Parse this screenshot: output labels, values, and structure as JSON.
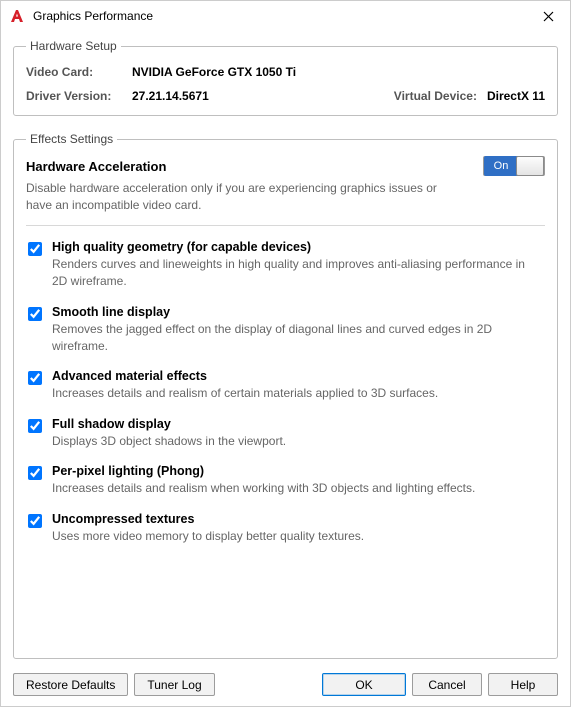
{
  "window": {
    "title": "Graphics Performance"
  },
  "hardware": {
    "legend": "Hardware Setup",
    "video_card_label": "Video Card:",
    "video_card_value": "NVIDIA GeForce GTX 1050 Ti",
    "driver_label": "Driver Version:",
    "driver_value": "27.21.14.5671",
    "virtual_device_label": "Virtual Device:",
    "virtual_device_value": "DirectX 11"
  },
  "effects": {
    "legend": "Effects Settings",
    "accel_title": "Hardware Acceleration",
    "toggle_on_label": "On",
    "toggle_state": true,
    "accel_desc": "Disable hardware acceleration only if you are experiencing graphics issues or have an incompatible video card.",
    "options": [
      {
        "checked": true,
        "title": "High quality geometry (for capable devices)",
        "desc": "Renders curves and lineweights in high quality and improves anti-aliasing performance in 2D wireframe."
      },
      {
        "checked": true,
        "title": "Smooth line display",
        "desc": "Removes the jagged effect on the display of diagonal lines and curved edges in 2D wireframe."
      },
      {
        "checked": true,
        "title": "Advanced material effects",
        "desc": "Increases details and realism of certain materials applied to 3D surfaces."
      },
      {
        "checked": true,
        "title": "Full shadow display",
        "desc": "Displays 3D object shadows in the viewport."
      },
      {
        "checked": true,
        "title": "Per-pixel lighting (Phong)",
        "desc": "Increases details and realism when working with 3D objects and lighting effects."
      },
      {
        "checked": true,
        "title": "Uncompressed textures",
        "desc": "Uses more video memory to display better quality textures."
      }
    ]
  },
  "buttons": {
    "restore": "Restore Defaults",
    "tuner": "Tuner Log",
    "ok": "OK",
    "cancel": "Cancel",
    "help": "Help"
  }
}
